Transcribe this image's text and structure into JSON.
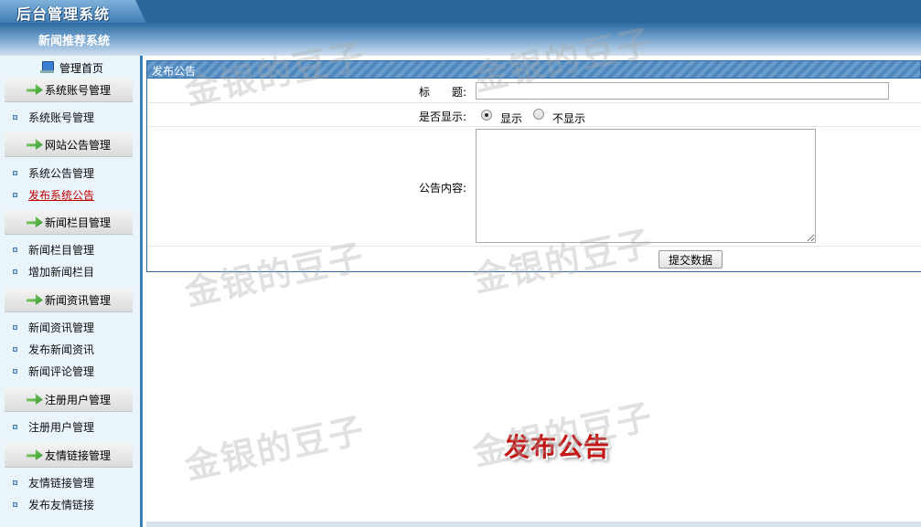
{
  "app": {
    "title": "后台管理系统",
    "system_name": "新闻推荐系统"
  },
  "sidebar": {
    "home": "管理首页",
    "sections": [
      {
        "title": "系统账号管理",
        "items": [
          {
            "label": "系统账号管理",
            "active": false
          }
        ]
      },
      {
        "title": "网站公告管理",
        "items": [
          {
            "label": "系统公告管理",
            "active": false
          },
          {
            "label": "发布系统公告",
            "active": true
          }
        ]
      },
      {
        "title": "新闻栏目管理",
        "items": [
          {
            "label": "新闻栏目管理",
            "active": false
          },
          {
            "label": "增加新闻栏目",
            "active": false
          }
        ]
      },
      {
        "title": "新闻资讯管理",
        "items": [
          {
            "label": "新闻资讯管理",
            "active": false
          },
          {
            "label": "发布新闻资讯",
            "active": false
          },
          {
            "label": "新闻评论管理",
            "active": false
          }
        ]
      },
      {
        "title": "注册用户管理",
        "items": [
          {
            "label": "注册用户管理",
            "active": false
          }
        ]
      },
      {
        "title": "友情链接管理",
        "items": [
          {
            "label": "友情链接管理",
            "active": false
          },
          {
            "label": "发布友情链接",
            "active": false
          }
        ]
      }
    ]
  },
  "panel": {
    "title": "发布公告",
    "form": {
      "title_label": "标　　题:",
      "title_value": "",
      "display_label": "是否显示:",
      "display_options": [
        "显示",
        "不显示"
      ],
      "display_selected": "显示",
      "content_label": "公告内容:",
      "content_value": "",
      "submit": "提交数据"
    }
  },
  "page_caption": "发布公告",
  "watermark": "金银的豆子",
  "colors": {
    "topbar": "#2c6597",
    "accent": "#3d7db5",
    "active_link": "#c00000",
    "caption": "#c41818"
  }
}
